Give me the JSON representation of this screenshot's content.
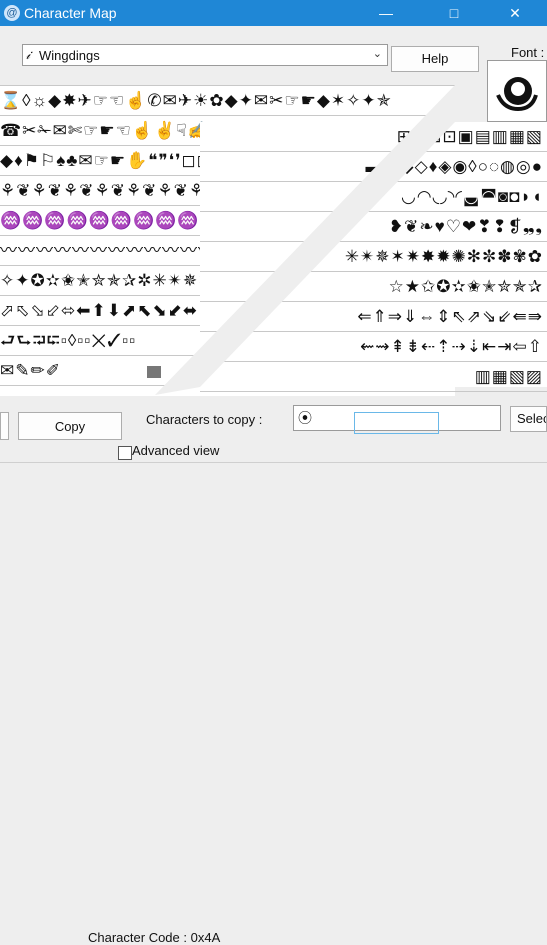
{
  "window": {
    "title": "Character Map",
    "app_icon": "character-map-icon"
  },
  "titlebar_controls": [
    "minimize",
    "maximize",
    "close"
  ],
  "font_dropdown": {
    "value": "Wingdings",
    "icon": "font-icon"
  },
  "help_label": "Help",
  "font_label": "Font :",
  "grid_rows_left": [
    "⌛◊☼◆✸✈☞☜☝✆✉✈☀✿◆✦✉✂☞☛◆✶✧✦✯",
    "☎✂✁✉✄☞☛☜☝✌☟✍☠☢☣☯☸☪■□▪▫◙",
    "◆♦⚑⚐♠♣✉☞☛✋❝❞❛❜◻◻◻◻◻◻◼",
    "⚘❦⚘❦⚘❦⚘❦⚘❦⚘❦⚘❦⚘❦⚘❦⚘❦",
    "♒♒♒♒♒♒♒♒♒▪▫▮⟨◆✦★✱✦",
    "〰〰〰〰〰〰〰〰〰〰〰〰〰〰",
    "✧✦✪✫✬✭✮✯✰✲✳✴✵✶",
    "⬀⬁⬂⬃⬄⬅⬆⬇⬈⬉⬊⬋⬌⬍",
    "⮐⮑⮒⮓▫◊▫▫✕✓▫▫",
    "✉✎✏✐"
  ],
  "grid_rows_right": [
    "⊞⊟⊠⊡▣▤▥▦▧",
    "▬▭◆◇♦◈◉◊○◌◍◎●",
    "◡◠◟◞◝◜◛◚◙◘◗◖",
    "❥❦❧♥♡❤❣❢❡❠❟",
    "✳✴✵✶✷✸✹✺✻✼✽✾✿",
    "☆★✩✪✫✬✭✮✯✰",
    "⇐⇑⇒⇓⇔⇕⇖⇗⇘⇙⇚⇛",
    "⇜⇝⇞⇟⇠⇡⇢⇣⇤⇥⇦⇧",
    "▥▦▧▨"
  ],
  "select_label": "Selec",
  "copy_label": "Copy",
  "characters_to_copy_label": "Characters to copy :",
  "characters_to_copy_value": "",
  "advanced_view_label": "Advanced view",
  "character_code_label": "Character Code : 0x4A"
}
